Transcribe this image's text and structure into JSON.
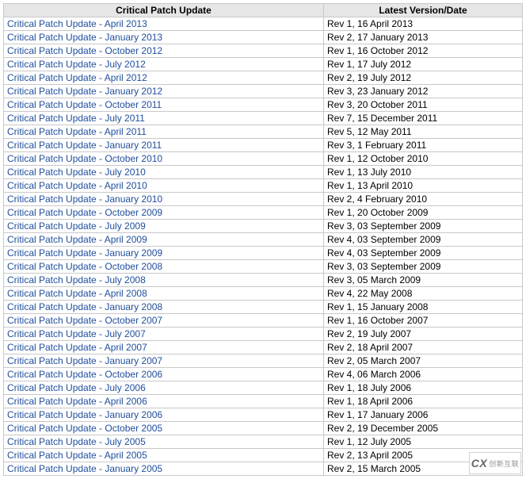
{
  "headers": {
    "col1": "Critical Patch Update",
    "col2": "Latest Version/Date"
  },
  "rows": [
    {
      "name": "Critical Patch Update - April 2013",
      "date": "Rev 1, 16 April 2013"
    },
    {
      "name": "Critical Patch Update - January 2013",
      "date": "Rev 2, 17 January 2013"
    },
    {
      "name": "Critical Patch Update - October 2012",
      "date": "Rev 1, 16 October 2012"
    },
    {
      "name": "Critical Patch Update - July 2012",
      "date": "Rev 1, 17 July 2012"
    },
    {
      "name": "Critical Patch Update - April 2012",
      "date": "Rev 2, 19 July 2012"
    },
    {
      "name": "Critical Patch Update - January 2012",
      "date": "Rev 3, 23 January 2012"
    },
    {
      "name": "Critical Patch Update - October 2011",
      "date": "Rev 3, 20 October 2011"
    },
    {
      "name": "Critical Patch Update - July 2011",
      "date": "Rev 7, 15 December 2011"
    },
    {
      "name": "Critical Patch Update - April 2011",
      "date": "Rev 5, 12 May 2011"
    },
    {
      "name": "Critical Patch Update - January 2011",
      "date": "Rev 3, 1 February 2011"
    },
    {
      "name": "Critical Patch Update - October 2010",
      "date": "Rev 1, 12 October 2010"
    },
    {
      "name": "Critical Patch Update - July 2010",
      "date": "Rev 1, 13 July 2010"
    },
    {
      "name": "Critical Patch Update - April 2010",
      "date": "Rev 1, 13 April 2010"
    },
    {
      "name": "Critical Patch Update - January 2010",
      "date": "Rev 2, 4 February 2010"
    },
    {
      "name": "Critical Patch Update - October 2009",
      "date": "Rev 1, 20 October 2009"
    },
    {
      "name": "Critical Patch Update - July 2009",
      "date": "Rev 3, 03 September 2009"
    },
    {
      "name": "Critical Patch Update - April 2009",
      "date": "Rev 4, 03 September 2009"
    },
    {
      "name": "Critical Patch Update - January 2009",
      "date": "Rev 4, 03 September 2009"
    },
    {
      "name": "Critical Patch Update - October 2008",
      "date": "Rev 3, 03 September 2009"
    },
    {
      "name": "Critical Patch Update - July 2008",
      "date": "Rev 3, 05 March 2009"
    },
    {
      "name": "Critical Patch Update - April 2008",
      "date": "Rev 4, 22 May 2008"
    },
    {
      "name": "Critical Patch Update - January 2008",
      "date": "Rev 1, 15 January 2008"
    },
    {
      "name": "Critical Patch Update - October 2007",
      "date": "Rev 1, 16 October 2007"
    },
    {
      "name": "Critical Patch Update - July 2007",
      "date": "Rev 2, 19 July 2007"
    },
    {
      "name": "Critical Patch Update - April 2007",
      "date": "Rev 2, 18 April 2007"
    },
    {
      "name": "Critical Patch Update - January 2007",
      "date": "Rev 2, 05 March 2007"
    },
    {
      "name": "Critical Patch Update - October 2006",
      "date": "Rev 4, 06 March 2006"
    },
    {
      "name": "Critical Patch Update - July 2006",
      "date": "Rev 1, 18 July 2006"
    },
    {
      "name": "Critical Patch Update - April 2006",
      "date": "Rev 1, 18 April 2006"
    },
    {
      "name": "Critical Patch Update - January 2006",
      "date": "Rev 1, 17 January 2006"
    },
    {
      "name": "Critical Patch Update - October 2005",
      "date": "Rev 2, 19 December 2005"
    },
    {
      "name": "Critical Patch Update - July 2005",
      "date": "Rev 1, 12 July 2005"
    },
    {
      "name": "Critical Patch Update - April 2005",
      "date": "Rev 2, 13 April 2005"
    },
    {
      "name": "Critical Patch Update - January 2005",
      "date": "Rev 2, 15 March 2005"
    }
  ],
  "watermark": {
    "brand_initials": "CX",
    "brand_text": "创新互联"
  }
}
